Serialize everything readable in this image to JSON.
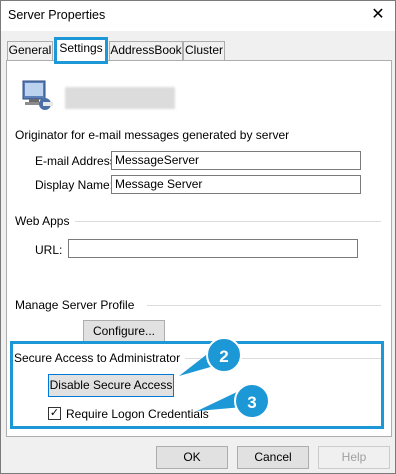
{
  "window": {
    "title": "Server Properties",
    "close_glyph": "✕"
  },
  "tabs": [
    {
      "label": "General"
    },
    {
      "label": "Settings"
    },
    {
      "label": "AddressBook"
    },
    {
      "label": "Cluster"
    }
  ],
  "originator": {
    "heading": "Originator for e-mail messages generated by server",
    "email_label": "E-mail Address:",
    "email_value": "MessageServer",
    "display_label": "Display Name:",
    "display_value": "Message Server"
  },
  "webapps": {
    "heading": "Web Apps",
    "url_label": "URL:",
    "url_value": ""
  },
  "profile": {
    "heading": "Manage Server Profile",
    "configure_label": "Configure..."
  },
  "secure": {
    "heading": "Secure Access to Administrator",
    "disable_label": "Disable Secure Access",
    "require_label": "Require Logon Credentials",
    "require_checked": "✓"
  },
  "callouts": {
    "two": "2",
    "three": "3"
  },
  "footer": {
    "ok": "OK",
    "cancel": "Cancel",
    "help": "Help"
  },
  "colors": {
    "accent": "#1d98d6"
  },
  "icons": {
    "server": "server-icon",
    "close": "close-icon"
  }
}
